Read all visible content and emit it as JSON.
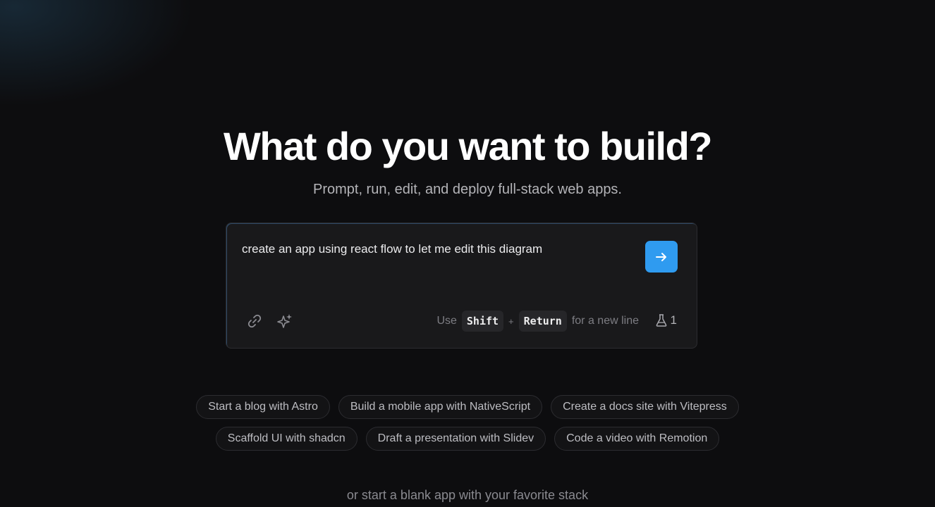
{
  "hero": {
    "title": "What do you want to build?",
    "subtitle": "Prompt, run, edit, and deploy full-stack web apps."
  },
  "prompt": {
    "value": "create an app using react flow to let me edit this diagram",
    "send_icon": "arrow-right-icon",
    "tools": [
      "link-icon",
      "sparkle-icon"
    ],
    "hint_use": "Use",
    "hint_key1": "Shift",
    "hint_plus": "+",
    "hint_key2": "Return",
    "hint_tail": "for a new line",
    "counter_icon": "flask-icon",
    "counter_value": "1"
  },
  "suggestions": {
    "row1": [
      "Start a blog with Astro",
      "Build a mobile app with NativeScript",
      "Create a docs site with Vitepress"
    ],
    "row2": [
      "Scaffold UI with shadcn",
      "Draft a presentation with Slidev",
      "Code a video with Remotion"
    ]
  },
  "footer": {
    "blank_link": "or start a blank app with your favorite stack"
  },
  "colors": {
    "accent": "#2f9bf0",
    "background": "#0d0d0f"
  }
}
